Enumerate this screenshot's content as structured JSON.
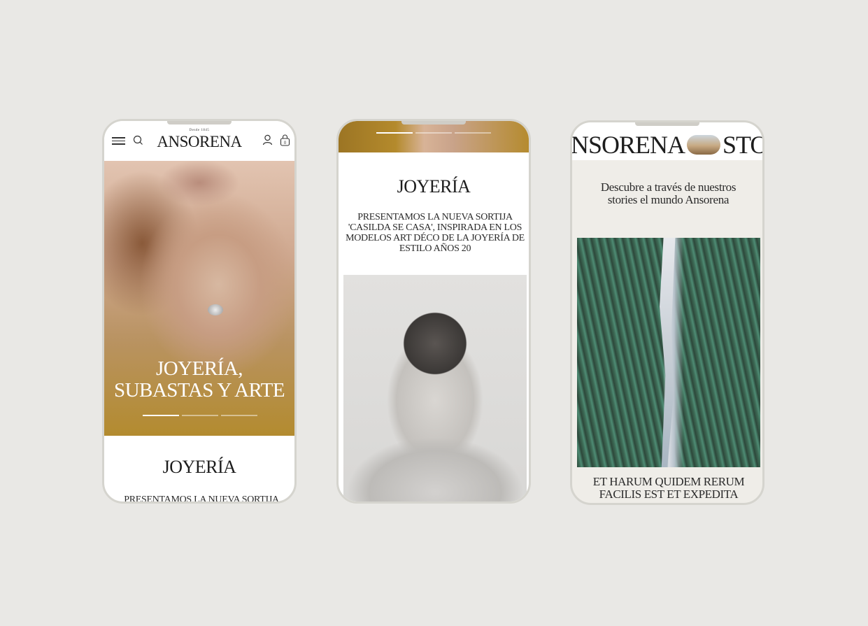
{
  "colors": {
    "background": "#e9e8e5",
    "phone_frame": "#d5d4ce",
    "stories_bg": "#efede8",
    "text": "#1d1d1d"
  },
  "phone1": {
    "since": "Desde 1845",
    "logo": "ANSORENA",
    "icons": [
      "menu-icon",
      "search-icon",
      "user-icon",
      "bag-icon"
    ],
    "bag_count": "0",
    "hero_title_line1": "JOYERÍA,",
    "hero_title_line2": "SUBASTAS Y ARTE",
    "slider_active": 1,
    "slider_total": 3,
    "section_title": "JOYERÍA",
    "section_text": "PRESENTAMOS LA NUEVA SORTIJA"
  },
  "phone2": {
    "slider_active": 1,
    "slider_total": 3,
    "section_title": "JOYERÍA",
    "section_text": "PRESENTAMOS LA NUEVA SORTIJA 'CASILDA SE CASA', INSPIRADA EN LOS MODELOS ART DÉCO DE LA JOYERÍA DE ESTILO AÑOS 20"
  },
  "phone3": {
    "marquee_left": "NSORENA",
    "marquee_right": "STOR",
    "intro": "Descubre a través de nuestros stories el mundo Ansorena",
    "caption": "ET HARUM QUIDEM RERUM FACILIS EST ET EXPEDITA DISTINCTIO. NAM LIBERO"
  }
}
